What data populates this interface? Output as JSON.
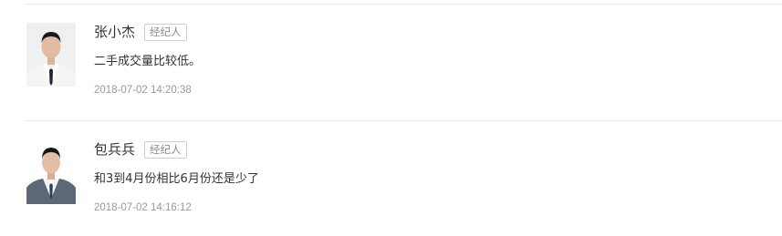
{
  "comments": [
    {
      "author": "张小杰",
      "badge": "经纪人",
      "text": "二手成交量比较低。",
      "time": "2018-07-02 14:20:38"
    },
    {
      "author": "包兵兵",
      "badge": "经纪人",
      "text": "和3到4月份相比6月份还是少了",
      "time": "2018-07-02 14:16:12"
    }
  ]
}
